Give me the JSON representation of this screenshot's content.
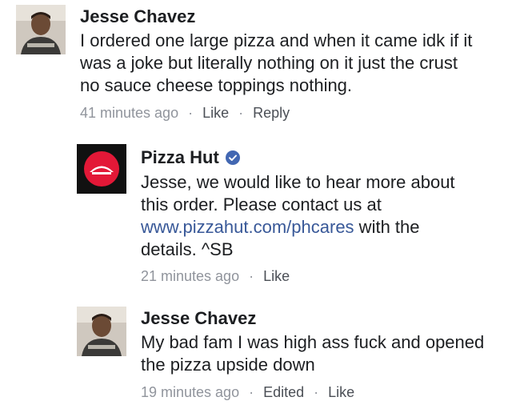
{
  "comments": [
    {
      "author": "Jesse Chavez",
      "text": "I ordered one large pizza and when it came idk if it was a joke but literally nothing on it just the crust no sauce cheese toppings nothing.",
      "time": "41 minutes ago",
      "actions": [
        "Like",
        "Reply"
      ]
    },
    {
      "author": "Pizza Hut",
      "verified_icon": "verified-badge-icon",
      "text_before_link": "Jesse, we would like to hear more about this order. Please contact us at ",
      "link": "www.pizzahut.com/phcares",
      "text_after_link": " with the details. ^SB",
      "time": "21 minutes ago",
      "actions": [
        "Like"
      ]
    },
    {
      "author": "Jesse Chavez",
      "text": "My bad fam I was high ass fuck and opened the pizza upside down",
      "time": "19 minutes ago",
      "actions": [
        "Edited",
        "Like"
      ]
    }
  ],
  "colors": {
    "link": "#385898",
    "meta": "#90949c",
    "verified": "#4267b2",
    "pizza_hut_red": "#e31837"
  }
}
